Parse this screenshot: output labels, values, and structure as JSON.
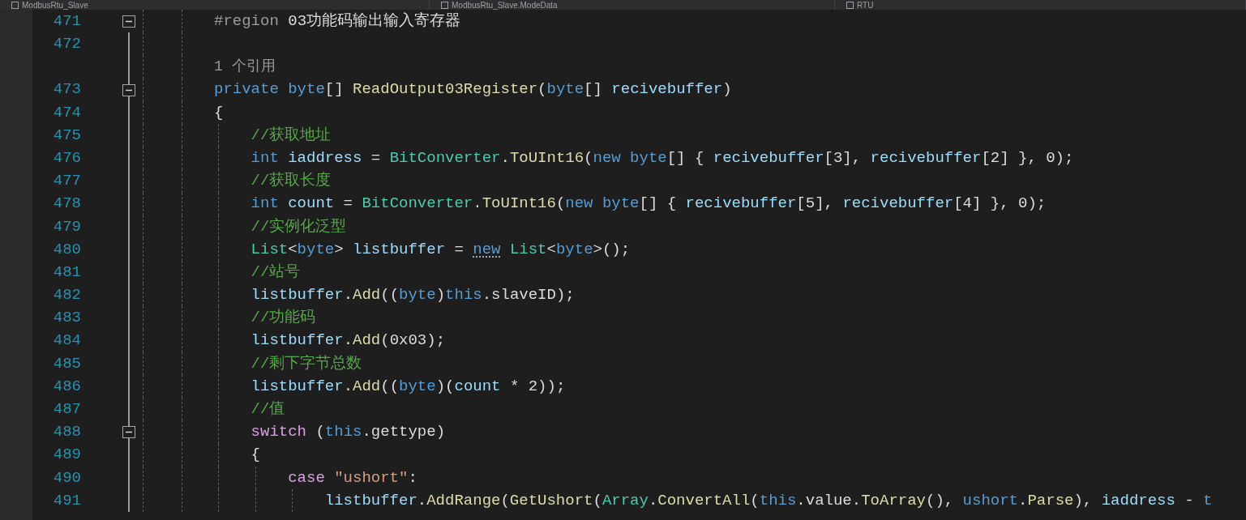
{
  "nav_bar": [
    {
      "label": "ModbusRtu_Slave"
    },
    {
      "label": "ModbusRtu_Slave.ModeData"
    },
    {
      "label": "RTU"
    }
  ],
  "editor": {
    "lines": [
      {
        "kind": "code",
        "number": "471",
        "fold_marker": true,
        "tokens": [
          {
            "kind": "preproc",
            "text": "#region"
          },
          {
            "kind": "plain",
            "text": " 03功能码输出输入寄存器"
          }
        ]
      },
      {
        "kind": "code",
        "number": "472",
        "fold_marker": false
      },
      {
        "kind": "codelens",
        "text": "1 个引用"
      },
      {
        "kind": "code",
        "number": "473",
        "fold_marker": true,
        "tokens": [
          {
            "kind": "keyword",
            "text": "private byte"
          },
          {
            "kind": "plain",
            "text": "[] "
          },
          {
            "kind": "method",
            "text": "ReadOutput03Register"
          },
          {
            "kind": "plain",
            "text": "("
          },
          {
            "kind": "keyword",
            "text": "byte"
          },
          {
            "kind": "plain",
            "text": "[] "
          },
          {
            "kind": "variable",
            "text": "recivebuffer"
          },
          {
            "kind": "plain",
            "text": ")"
          }
        ]
      },
      {
        "kind": "code",
        "number": "474",
        "fold_marker": false,
        "tokens": [
          {
            "kind": "plain",
            "text": "{"
          }
        ],
        "children": [
          {
            "kind": "code",
            "number": "475",
            "fold_marker": false,
            "tokens": [
              {
                "kind": "comment",
                "text": "//获取地址"
              }
            ]
          },
          {
            "kind": "code",
            "number": "476",
            "fold_marker": false,
            "tokens": [
              {
                "kind": "keyword",
                "text": "int "
              },
              {
                "kind": "variable",
                "text": "iaddress"
              },
              {
                "kind": "plain",
                "text": " = "
              },
              {
                "kind": "type",
                "text": "BitConverter"
              },
              {
                "kind": "plain",
                "text": "."
              },
              {
                "kind": "method",
                "text": "ToUInt16"
              },
              {
                "kind": "plain",
                "text": "("
              },
              {
                "kind": "keyword",
                "text": "new byte"
              },
              {
                "kind": "plain",
                "text": "[] { "
              },
              {
                "kind": "variable",
                "text": "recivebuffer"
              },
              {
                "kind": "plain",
                "text": "[3], "
              },
              {
                "kind": "variable",
                "text": "recivebuffer"
              },
              {
                "kind": "plain",
                "text": "[2] }, 0);"
              }
            ]
          },
          {
            "kind": "code",
            "number": "477",
            "fold_marker": false,
            "tokens": [
              {
                "kind": "comment",
                "text": "//获取长度"
              }
            ]
          },
          {
            "kind": "code",
            "number": "478",
            "fold_marker": false,
            "tokens": [
              {
                "kind": "keyword",
                "text": "int "
              },
              {
                "kind": "variable",
                "text": "count"
              },
              {
                "kind": "plain",
                "text": " = "
              },
              {
                "kind": "type",
                "text": "BitConverter"
              },
              {
                "kind": "plain",
                "text": "."
              },
              {
                "kind": "method",
                "text": "ToUInt16"
              },
              {
                "kind": "plain",
                "text": "("
              },
              {
                "kind": "keyword",
                "text": "new byte"
              },
              {
                "kind": "plain",
                "text": "[] { "
              },
              {
                "kind": "variable",
                "text": "recivebuffer"
              },
              {
                "kind": "plain",
                "text": "[5], "
              },
              {
                "kind": "variable",
                "text": "recivebuffer"
              },
              {
                "kind": "plain",
                "text": "[4] }, 0);"
              }
            ]
          },
          {
            "kind": "code",
            "number": "479",
            "fold_marker": false,
            "tokens": [
              {
                "kind": "comment",
                "text": "//实例化泛型"
              }
            ]
          },
          {
            "kind": "code",
            "number": "480",
            "fold_marker": false,
            "tokens": [
              {
                "kind": "type",
                "text": "List"
              },
              {
                "kind": "plain",
                "text": "<"
              },
              {
                "kind": "keyword",
                "text": "byte"
              },
              {
                "kind": "plain",
                "text": "> "
              },
              {
                "kind": "variable",
                "text": "listbuffer"
              },
              {
                "kind": "plain",
                "text": " = "
              },
              {
                "kind": "keyword",
                "text": "new",
                "suggestion": true
              },
              {
                "kind": "type",
                "text": " List"
              },
              {
                "kind": "plain",
                "text": "<"
              },
              {
                "kind": "keyword",
                "text": "byte"
              },
              {
                "kind": "plain",
                "text": ">();"
              }
            ]
          },
          {
            "kind": "code",
            "number": "481",
            "fold_marker": false,
            "tokens": [
              {
                "kind": "comment",
                "text": "//站号"
              }
            ]
          },
          {
            "kind": "code",
            "number": "482",
            "fold_marker": false,
            "tokens": [
              {
                "kind": "variable",
                "text": "listbuffer"
              },
              {
                "kind": "plain",
                "text": "."
              },
              {
                "kind": "method",
                "text": "Add"
              },
              {
                "kind": "plain",
                "text": "(("
              },
              {
                "kind": "keyword",
                "text": "byte"
              },
              {
                "kind": "plain",
                "text": ")"
              },
              {
                "kind": "keyword",
                "text": "this"
              },
              {
                "kind": "plain",
                "text": ".slaveID);"
              }
            ]
          },
          {
            "kind": "code",
            "number": "483",
            "fold_marker": false,
            "tokens": [
              {
                "kind": "comment",
                "text": "//功能码"
              }
            ]
          },
          {
            "kind": "code",
            "number": "484",
            "fold_marker": false,
            "tokens": [
              {
                "kind": "variable",
                "text": "listbuffer"
              },
              {
                "kind": "plain",
                "text": "."
              },
              {
                "kind": "method",
                "text": "Add"
              },
              {
                "kind": "plain",
                "text": "(0x03);"
              }
            ]
          },
          {
            "kind": "code",
            "number": "485",
            "fold_marker": false,
            "tokens": [
              {
                "kind": "comment",
                "text": "//剩下字节总数"
              }
            ]
          },
          {
            "kind": "code",
            "number": "486",
            "fold_marker": false,
            "tokens": [
              {
                "kind": "variable",
                "text": "listbuffer"
              },
              {
                "kind": "plain",
                "text": "."
              },
              {
                "kind": "method",
                "text": "Add"
              },
              {
                "kind": "plain",
                "text": "(("
              },
              {
                "kind": "keyword",
                "text": "byte"
              },
              {
                "kind": "plain",
                "text": ")("
              },
              {
                "kind": "variable",
                "text": "count"
              },
              {
                "kind": "plain",
                "text": " * 2));"
              }
            ]
          },
          {
            "kind": "code",
            "number": "487",
            "fold_marker": false,
            "tokens": [
              {
                "kind": "comment",
                "text": "//值"
              }
            ]
          },
          {
            "kind": "code",
            "number": "488",
            "fold_marker": true,
            "tokens": [
              {
                "kind": "control",
                "text": "switch"
              },
              {
                "kind": "plain",
                "text": " ("
              },
              {
                "kind": "keyword",
                "text": "this"
              },
              {
                "kind": "plain",
                "text": ".gettype)"
              }
            ]
          },
          {
            "kind": "code",
            "number": "489",
            "fold_marker": false,
            "tokens": [
              {
                "kind": "plain",
                "text": "{"
              }
            ],
            "children": [
              {
                "kind": "code",
                "number": "490",
                "fold_marker": false,
                "tokens": [
                  {
                    "kind": "control",
                    "text": "case"
                  },
                  {
                    "kind": "string",
                    "text": " \"ushort\""
                  },
                  {
                    "kind": "plain",
                    "text": ":"
                  }
                ],
                "children": [
                  {
                    "kind": "code",
                    "number": "491",
                    "fold_marker": false,
                    "tokens": [
                      {
                        "kind": "variable",
                        "text": "listbuffer"
                      },
                      {
                        "kind": "plain",
                        "text": "."
                      },
                      {
                        "kind": "method",
                        "text": "AddRange"
                      },
                      {
                        "kind": "plain",
                        "text": "("
                      },
                      {
                        "kind": "method",
                        "text": "GetUshort"
                      },
                      {
                        "kind": "plain",
                        "text": "("
                      },
                      {
                        "kind": "type",
                        "text": "Array"
                      },
                      {
                        "kind": "plain",
                        "text": "."
                      },
                      {
                        "kind": "method",
                        "text": "ConvertAll"
                      },
                      {
                        "kind": "plain",
                        "text": "("
                      },
                      {
                        "kind": "keyword",
                        "text": "this"
                      },
                      {
                        "kind": "plain",
                        "text": ".value."
                      },
                      {
                        "kind": "method",
                        "text": "ToArray"
                      },
                      {
                        "kind": "plain",
                        "text": "(), "
                      },
                      {
                        "kind": "keyword",
                        "text": "ushort"
                      },
                      {
                        "kind": "plain",
                        "text": "."
                      },
                      {
                        "kind": "method",
                        "text": "Parse"
                      },
                      {
                        "kind": "plain",
                        "text": "), "
                      },
                      {
                        "kind": "variable",
                        "text": "iaddress"
                      },
                      {
                        "kind": "plain",
                        "text": " - "
                      },
                      {
                        "kind": "keyword",
                        "text": "t"
                      }
                    ]
                  }
                ]
              }
            ]
          }
        ]
      }
    ]
  }
}
